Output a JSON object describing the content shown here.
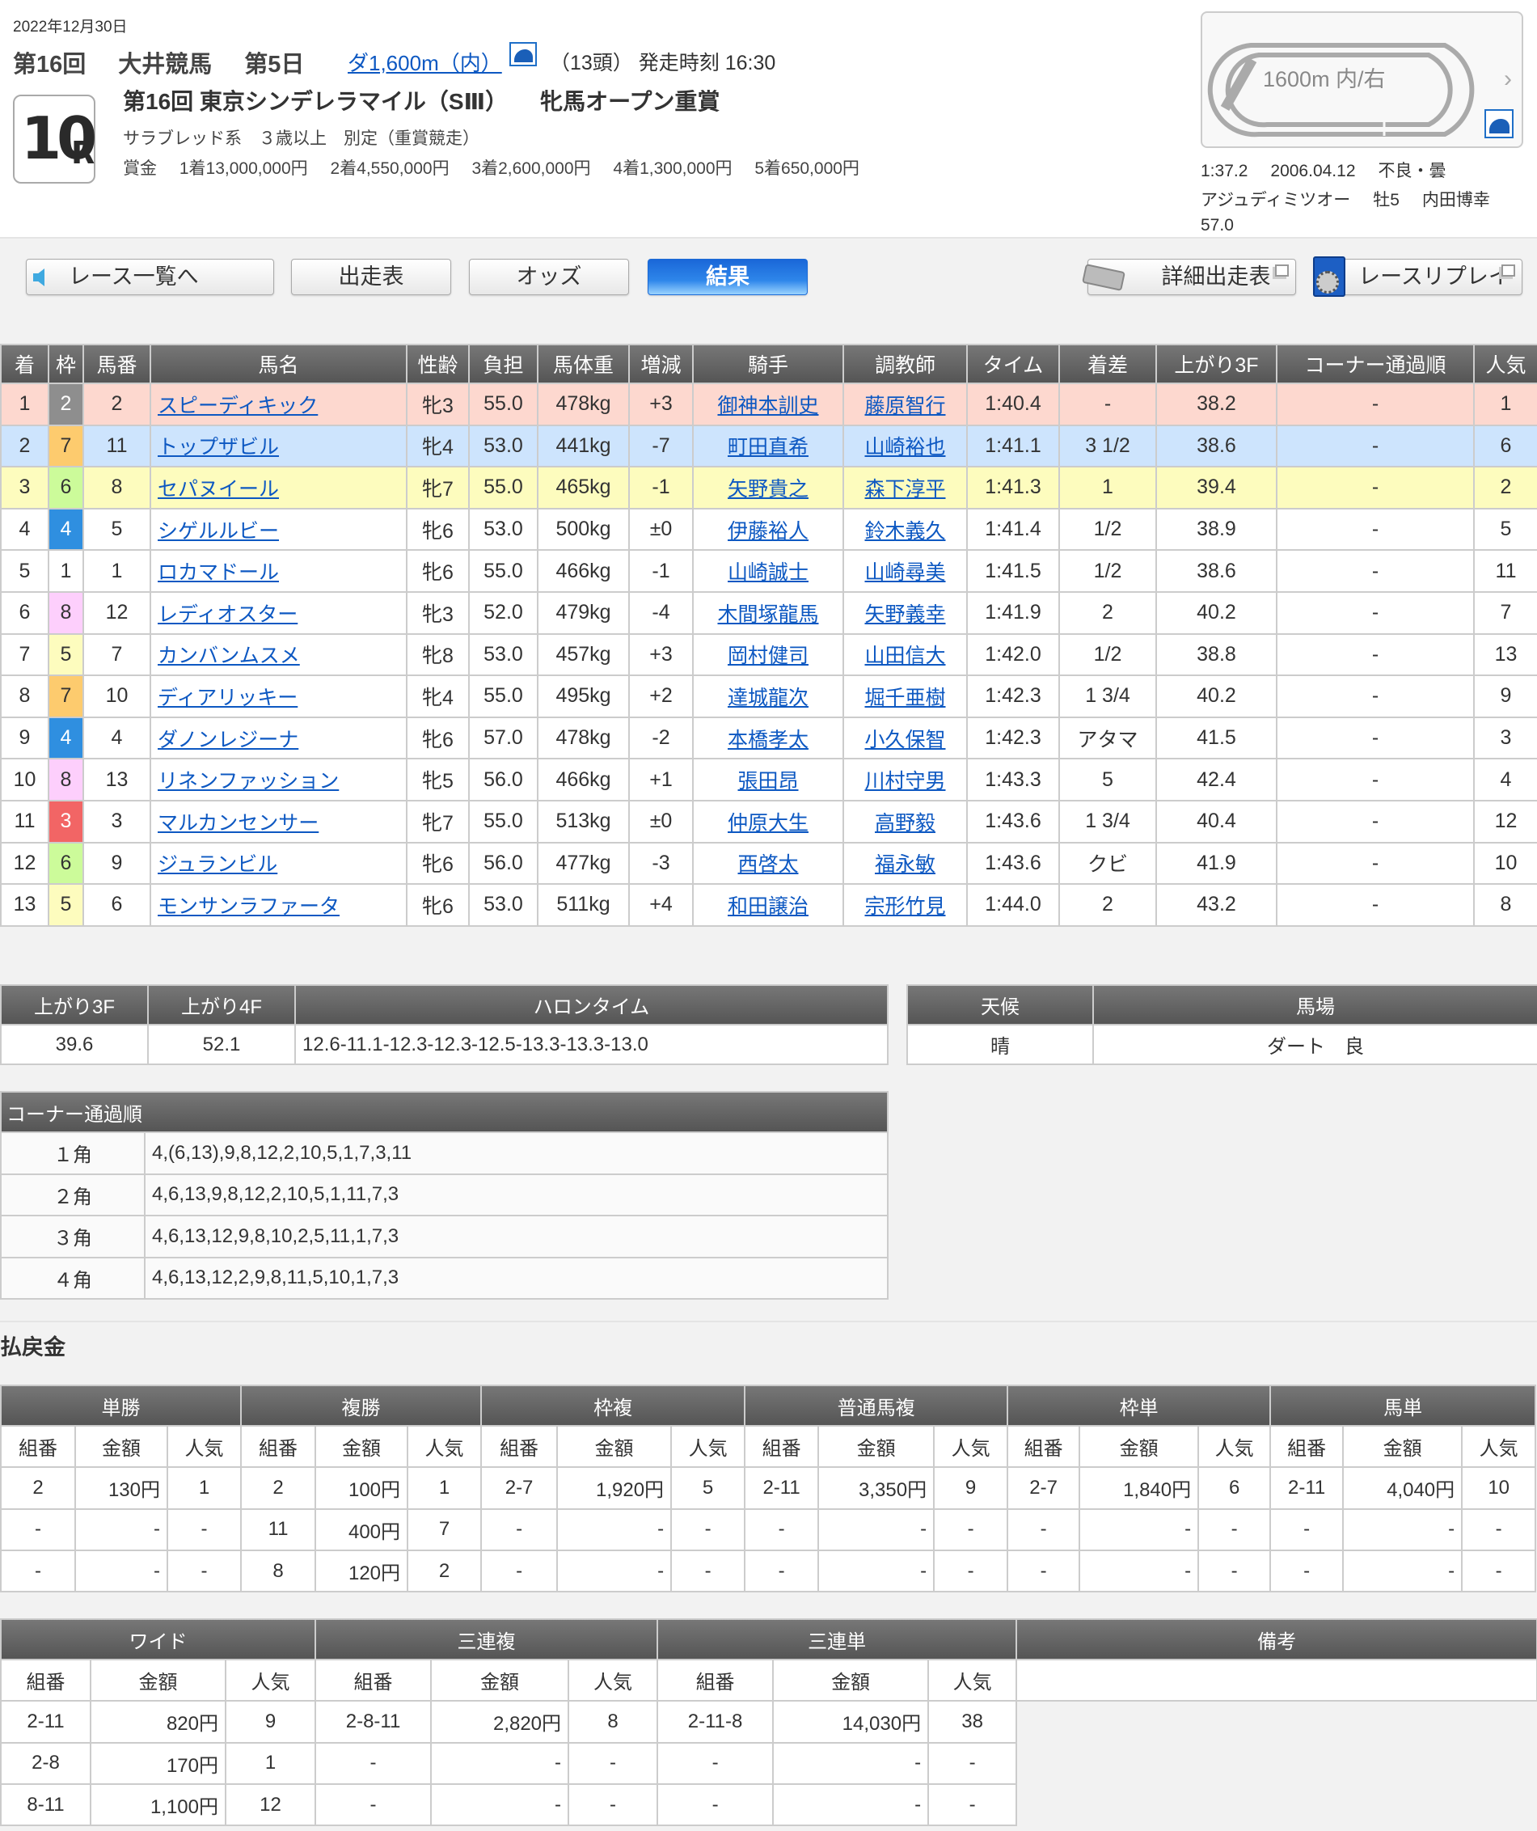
{
  "header": {
    "date": "2022年12月30日",
    "meeting": [
      "第16回",
      "大井競馬",
      "第5日"
    ],
    "distance_link": "ダ1,600m（内）",
    "field_and_start": "（13頭） 発走時刻 16:30",
    "race_number": "10",
    "race_number_suffix": "R",
    "race_title": "第16回 東京シンデレラマイル（SⅢ）",
    "race_class": "牝馬オープン重賞",
    "conditions": "サラブレッド系　３歳以上　別定（重賞競走）",
    "prize_label": "賞金",
    "prizes": [
      "1着13,000,000円",
      "2着4,550,000円",
      "3着2,600,000円",
      "4着1,300,000円",
      "5着650,000円"
    ]
  },
  "course": {
    "label": "1600m  内/右",
    "start_marker": "0",
    "record_line1": [
      "1:37.2",
      "2006.04.12",
      "不良・曇"
    ],
    "record_line2": [
      "アジュディミツオー",
      "牡5",
      "内田博幸"
    ],
    "record_line3": "57.0"
  },
  "nav": {
    "race_list": "レース一覧へ",
    "entries": "出走表",
    "odds": "オッズ",
    "result": "結果",
    "detailed_entries": "詳細出走表",
    "replay": "レースリプレイ"
  },
  "results": {
    "headers": [
      "着",
      "枠",
      "馬番",
      "馬名",
      "性齢",
      "負担",
      "馬体重",
      "増減",
      "騎手",
      "調教師",
      "タイム",
      "着差",
      "上がり3F",
      "コーナー通過順",
      "人気"
    ],
    "rows": [
      {
        "pos": "1",
        "waku": "2",
        "num": "2",
        "horse": "スピーディキック",
        "sexage": "牝3",
        "weight": "55.0",
        "body": "478kg",
        "diff": "+3",
        "jockey": "御神本訓史",
        "trainer": "藤原智行",
        "time": "1:40.4",
        "margin": "-",
        "last3f": "38.2",
        "corner": "-",
        "pop": "1"
      },
      {
        "pos": "2",
        "waku": "7",
        "num": "11",
        "horse": "トップザビル",
        "sexage": "牝4",
        "weight": "53.0",
        "body": "441kg",
        "diff": "-7",
        "jockey": "町田直希",
        "trainer": "山崎裕也",
        "time": "1:41.1",
        "margin": "3 1/2",
        "last3f": "38.6",
        "corner": "-",
        "pop": "6"
      },
      {
        "pos": "3",
        "waku": "6",
        "num": "8",
        "horse": "セパヌイール",
        "sexage": "牝7",
        "weight": "55.0",
        "body": "465kg",
        "diff": "-1",
        "jockey": "矢野貴之",
        "trainer": "森下淳平",
        "time": "1:41.3",
        "margin": "1",
        "last3f": "39.4",
        "corner": "-",
        "pop": "2"
      },
      {
        "pos": "4",
        "waku": "4",
        "num": "5",
        "horse": "シゲルルビー",
        "sexage": "牝6",
        "weight": "53.0",
        "body": "500kg",
        "diff": "±0",
        "jockey": "伊藤裕人",
        "trainer": "鈴木義久",
        "time": "1:41.4",
        "margin": "1/2",
        "last3f": "38.9",
        "corner": "-",
        "pop": "5"
      },
      {
        "pos": "5",
        "waku": "1",
        "num": "1",
        "horse": "ロカマドール",
        "sexage": "牝6",
        "weight": "55.0",
        "body": "466kg",
        "diff": "-1",
        "jockey": "山崎誠士",
        "trainer": "山崎尋美",
        "time": "1:41.5",
        "margin": "1/2",
        "last3f": "38.6",
        "corner": "-",
        "pop": "11"
      },
      {
        "pos": "6",
        "waku": "8",
        "num": "12",
        "horse": "レディオスター",
        "sexage": "牝3",
        "weight": "52.0",
        "body": "479kg",
        "diff": "-4",
        "jockey": "木間塚龍馬",
        "trainer": "矢野義幸",
        "time": "1:41.9",
        "margin": "2",
        "last3f": "40.2",
        "corner": "-",
        "pop": "7"
      },
      {
        "pos": "7",
        "waku": "5",
        "num": "7",
        "horse": "カンバンムスメ",
        "sexage": "牝8",
        "weight": "53.0",
        "body": "457kg",
        "diff": "+3",
        "jockey": "岡村健司",
        "trainer": "山田信大",
        "time": "1:42.0",
        "margin": "1/2",
        "last3f": "38.8",
        "corner": "-",
        "pop": "13"
      },
      {
        "pos": "8",
        "waku": "7",
        "num": "10",
        "horse": "ディアリッキー",
        "sexage": "牝4",
        "weight": "55.0",
        "body": "495kg",
        "diff": "+2",
        "jockey": "達城龍次",
        "trainer": "堀千亜樹",
        "time": "1:42.3",
        "margin": "1 3/4",
        "last3f": "40.2",
        "corner": "-",
        "pop": "9"
      },
      {
        "pos": "9",
        "waku": "4",
        "num": "4",
        "horse": "ダノンレジーナ",
        "sexage": "牝6",
        "weight": "57.0",
        "body": "478kg",
        "diff": "-2",
        "jockey": "本橋孝太",
        "trainer": "小久保智",
        "time": "1:42.3",
        "margin": "アタマ",
        "last3f": "41.5",
        "corner": "-",
        "pop": "3"
      },
      {
        "pos": "10",
        "waku": "8",
        "num": "13",
        "horse": "リネンファッション",
        "sexage": "牝5",
        "weight": "56.0",
        "body": "466kg",
        "diff": "+1",
        "jockey": "張田昂",
        "trainer": "川村守男",
        "time": "1:43.3",
        "margin": "5",
        "last3f": "42.4",
        "corner": "-",
        "pop": "4"
      },
      {
        "pos": "11",
        "waku": "3",
        "num": "3",
        "horse": "マルカンセンサー",
        "sexage": "牝7",
        "weight": "55.0",
        "body": "513kg",
        "diff": "±0",
        "jockey": "仲原大生",
        "trainer": "高野毅",
        "time": "1:43.6",
        "margin": "1 3/4",
        "last3f": "40.4",
        "corner": "-",
        "pop": "12"
      },
      {
        "pos": "12",
        "waku": "6",
        "num": "9",
        "horse": "ジュランビル",
        "sexage": "牝6",
        "weight": "56.0",
        "body": "477kg",
        "diff": "-3",
        "jockey": "西啓太",
        "trainer": "福永敏",
        "time": "1:43.6",
        "margin": "クビ",
        "last3f": "41.9",
        "corner": "-",
        "pop": "10"
      },
      {
        "pos": "13",
        "waku": "5",
        "num": "6",
        "horse": "モンサンラファータ",
        "sexage": "牝6",
        "weight": "53.0",
        "body": "511kg",
        "diff": "+4",
        "jockey": "和田譲治",
        "trainer": "宗形竹見",
        "time": "1:44.0",
        "margin": "2",
        "last3f": "43.2",
        "corner": "-",
        "pop": "8"
      }
    ]
  },
  "waku_colors": {
    "1": {
      "bg": "#ffffff",
      "fg": "#333333"
    },
    "2": {
      "bg": "#8e8e8e",
      "fg": "#ffffff"
    },
    "3": {
      "bg": "#f26565",
      "fg": "#ffffff"
    },
    "4": {
      "bg": "#2f8fe0",
      "fg": "#ffffff"
    },
    "5": {
      "bg": "#fdfcbe",
      "fg": "#333333"
    },
    "6": {
      "bg": "#ccfb9a",
      "fg": "#333333"
    },
    "7": {
      "bg": "#fdcb6e",
      "fg": "#333333"
    },
    "8": {
      "bg": "#fdcffc",
      "fg": "#333333"
    }
  },
  "laps": {
    "headers": [
      "上がり3F",
      "上がり4F",
      "ハロンタイム"
    ],
    "last3f": "39.6",
    "last4f": "52.1",
    "furlongs": "12.6-11.1-12.3-12.3-12.5-13.3-13.3-13.0"
  },
  "weather": {
    "headers": [
      "天候",
      "馬場"
    ],
    "weather": "晴",
    "track": "ダート　良"
  },
  "corners": {
    "title": "コーナー通過順",
    "rows": [
      {
        "label": "１角",
        "order": "4,(6,13),9,8,12,2,10,5,1,7,3,11"
      },
      {
        "label": "２角",
        "order": "4,6,13,9,8,12,2,10,5,1,11,7,3"
      },
      {
        "label": "３角",
        "order": "4,6,13,12,9,8,10,2,5,11,1,7,3"
      },
      {
        "label": "４角",
        "order": "4,6,13,12,2,9,8,11,5,10,1,7,3"
      }
    ]
  },
  "payout": {
    "title": "払戻金",
    "sub_headers": [
      "組番",
      "金額",
      "人気"
    ],
    "table1": {
      "groups": [
        "単勝",
        "複勝",
        "枠複",
        "普通馬複",
        "枠単",
        "馬単"
      ],
      "rows": [
        [
          "2",
          "130円",
          "1",
          "2",
          "100円",
          "1",
          "2-7",
          "1,920円",
          "5",
          "2-11",
          "3,350円",
          "9",
          "2-7",
          "1,840円",
          "6",
          "2-11",
          "4,040円",
          "10"
        ],
        [
          "-",
          "-",
          "-",
          "11",
          "400円",
          "7",
          "-",
          "-",
          "-",
          "-",
          "-",
          "-",
          "-",
          "-",
          "-",
          "-",
          "-",
          "-"
        ],
        [
          "-",
          "-",
          "-",
          "8",
          "120円",
          "2",
          "-",
          "-",
          "-",
          "-",
          "-",
          "-",
          "-",
          "-",
          "-",
          "-",
          "-",
          "-"
        ]
      ]
    },
    "table2": {
      "groups": [
        "ワイド",
        "三連複",
        "三連単"
      ],
      "remarks_header": "備考",
      "remarks": "",
      "rows": [
        [
          "2-11",
          "820円",
          "9",
          "2-8-11",
          "2,820円",
          "8",
          "2-11-8",
          "14,030円",
          "38"
        ],
        [
          "2-8",
          "170円",
          "1",
          "-",
          "-",
          "-",
          "-",
          "-",
          "-"
        ],
        [
          "8-11",
          "1,100円",
          "12",
          "-",
          "-",
          "-",
          "-",
          "-",
          "-"
        ]
      ]
    }
  }
}
